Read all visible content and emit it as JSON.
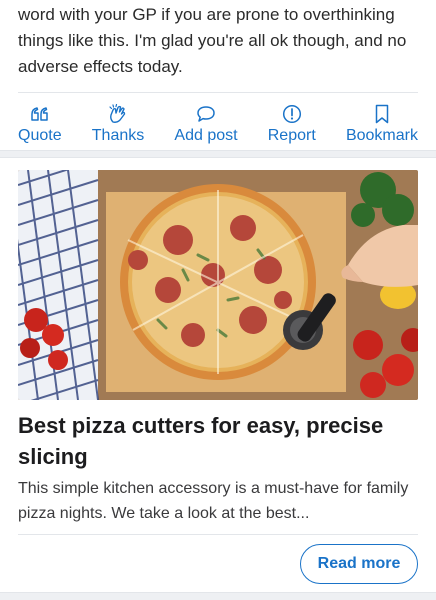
{
  "post": {
    "body": "word with your GP if you are prone to overthinking things like this. I'm glad you're all ok though, and no adverse effects today."
  },
  "actions": [
    {
      "label": "Quote",
      "icon": "quote-icon"
    },
    {
      "label": "Thanks",
      "icon": "clapping-hands-icon"
    },
    {
      "label": "Add post",
      "icon": "speech-bubble-icon"
    },
    {
      "label": "Report",
      "icon": "alert-circle-icon"
    },
    {
      "label": "Bookmark",
      "icon": "bookmark-icon"
    }
  ],
  "promo": {
    "image_alt": "Pizza being cut with a pizza cutter wheel",
    "title": "Best pizza cutters for easy, precise slicing",
    "description": "This simple kitchen accessory is a must-have for family pizza nights. We take a look at the best...",
    "button_label": "Read more"
  },
  "colors": {
    "accent": "#1a73c8",
    "separator": "#eef0f3"
  }
}
